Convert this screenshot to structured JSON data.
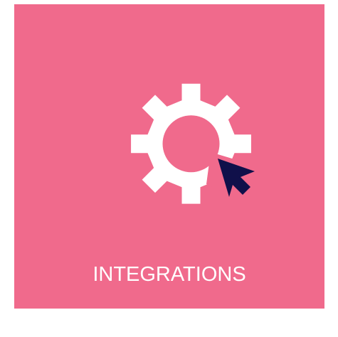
{
  "tile": {
    "label": "INTEGRATIONS",
    "background_color": "#f06a8c",
    "text_color": "#ffffff"
  },
  "icons": {
    "gear": "gear-icon",
    "cursor": "cursor-arrow-icon",
    "gear_color": "#ffffff",
    "cursor_color": "#10104a"
  }
}
